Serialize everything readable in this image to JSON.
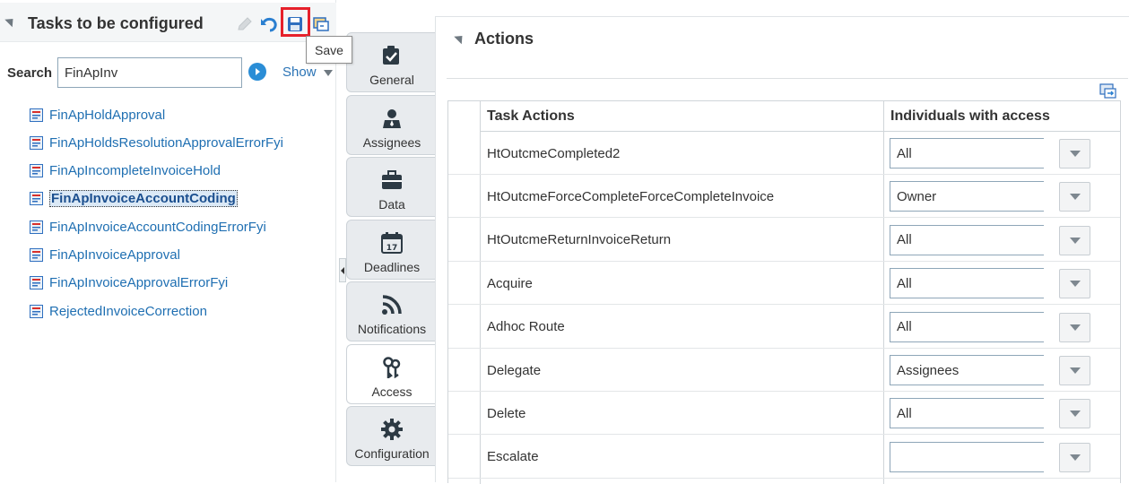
{
  "left_panel": {
    "title": "Tasks to be configured",
    "icons": [
      "edit-pencil-icon",
      "undo-icon",
      "save-icon",
      "task-config-icon"
    ],
    "tooltip": "Save",
    "search": {
      "label": "Search",
      "value": "FinApInv"
    },
    "show_label": "Show",
    "tasks": [
      {
        "label": "FinApHoldApproval",
        "selected": false
      },
      {
        "label": "FinApHoldsResolutionApprovalErrorFyi",
        "selected": false
      },
      {
        "label": "FinApIncompleteInvoiceHold",
        "selected": false
      },
      {
        "label": "FinApInvoiceAccountCoding",
        "selected": true
      },
      {
        "label": "FinApInvoiceAccountCodingErrorFyi",
        "selected": false
      },
      {
        "label": "FinApInvoiceApproval",
        "selected": false
      },
      {
        "label": "FinApInvoiceApprovalErrorFyi",
        "selected": false
      },
      {
        "label": "RejectedInvoiceCorrection",
        "selected": false
      }
    ]
  },
  "tabs": [
    {
      "label": "General",
      "icon": "checkbox-icon",
      "active": false
    },
    {
      "label": "Assignees",
      "icon": "person-icon",
      "active": false
    },
    {
      "label": "Data",
      "icon": "briefcase-icon",
      "active": false
    },
    {
      "label": "Deadlines",
      "icon": "calendar-icon",
      "active": false
    },
    {
      "label": "Notifications",
      "icon": "rss-icon",
      "active": false
    },
    {
      "label": "Access",
      "icon": "keys-icon",
      "active": true
    },
    {
      "label": "Configuration",
      "icon": "gear-icon",
      "active": false
    }
  ],
  "actions": {
    "title": "Actions",
    "columns": [
      "Task Actions",
      "Individuals with access"
    ],
    "rows": [
      {
        "action": "HtOutcmeCompleted2",
        "access": "All"
      },
      {
        "action": "HtOutcmeForceCompleteForceCompleteInvoice",
        "access": "Owner"
      },
      {
        "action": "HtOutcmeReturnInvoiceReturn",
        "access": "All"
      },
      {
        "action": "Acquire",
        "access": "All"
      },
      {
        "action": "Adhoc Route",
        "access": "All"
      },
      {
        "action": "Delegate",
        "access": "Assignees"
      },
      {
        "action": "Delete",
        "access": "All"
      },
      {
        "action": "Escalate",
        "access": ""
      }
    ]
  },
  "colors": {
    "link": "#1f6fb2",
    "highlight_box": "#e6212b",
    "go_button": "#2a8dd6"
  }
}
